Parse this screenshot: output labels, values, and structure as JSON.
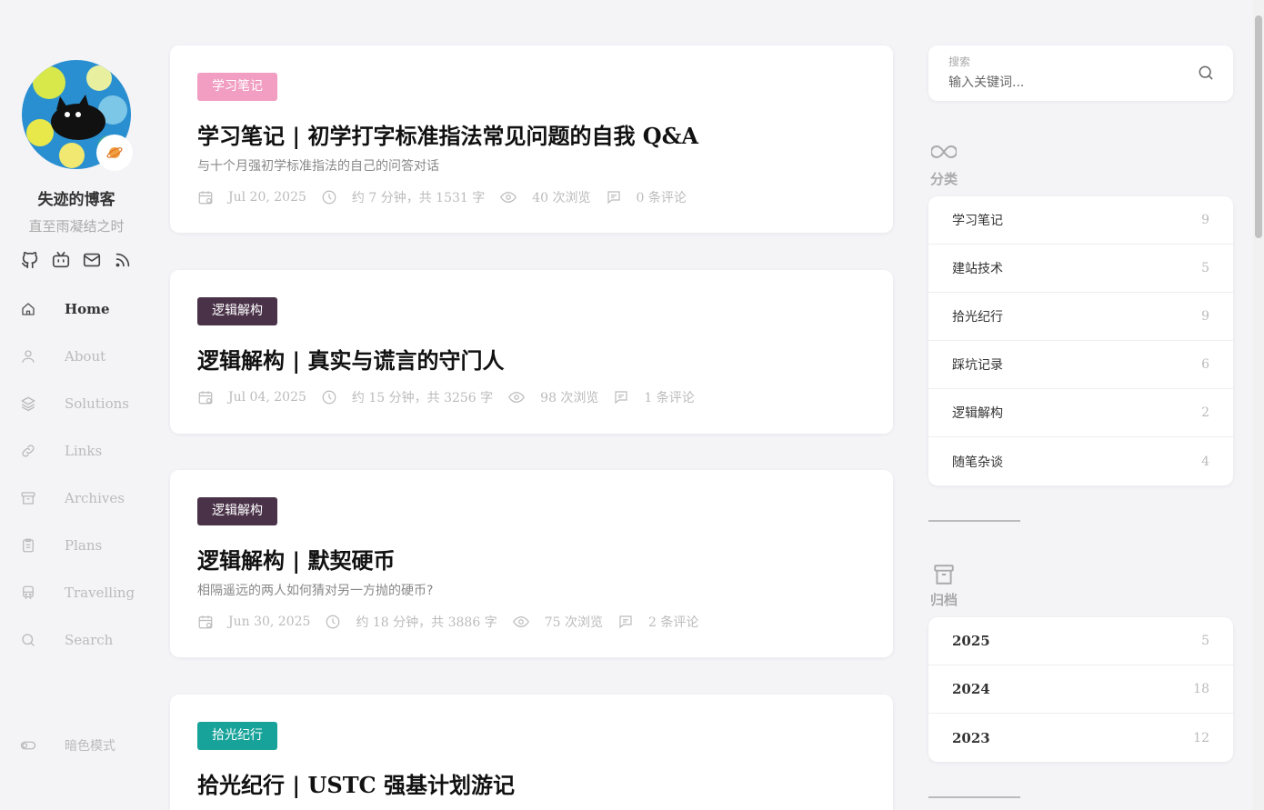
{
  "sidebar": {
    "blog_name": "失迹的博客",
    "motto": "直至雨凝结之时",
    "social": [
      "github-icon",
      "bilibili-icon",
      "mail-icon",
      "rss-icon"
    ],
    "nav": [
      {
        "label": "Home",
        "icon": "home-icon",
        "active": true
      },
      {
        "label": "About",
        "icon": "user-icon"
      },
      {
        "label": "Solutions",
        "icon": "layers-icon"
      },
      {
        "label": "Links",
        "icon": "link-icon"
      },
      {
        "label": "Archives",
        "icon": "archive-icon"
      },
      {
        "label": "Plans",
        "icon": "clipboard-icon"
      },
      {
        "label": "Travelling",
        "icon": "train-icon"
      },
      {
        "label": "Search",
        "icon": "search-icon"
      }
    ],
    "dark_mode_label": "暗色模式"
  },
  "posts": [
    {
      "tag": "学习笔记",
      "tag_color": "#f19ec2",
      "title": "学习笔记 | 初学打字标准指法常见问题的自我 Q&A",
      "subtitle": "与十个月强初学标准指法的自己的问答对话",
      "date": "Jul 20, 2025",
      "read": "约 7 分钟，共 1531 字",
      "views": "40 次浏览",
      "comments": "0 条评论"
    },
    {
      "tag": "逻辑解构",
      "tag_color": "#4a3349",
      "title": "逻辑解构 | 真实与谎言的守门人",
      "subtitle": "",
      "date": "Jul 04, 2025",
      "read": "约 15 分钟，共 3256 字",
      "views": "98 次浏览",
      "comments": "1 条评论"
    },
    {
      "tag": "逻辑解构",
      "tag_color": "#4a3349",
      "title": "逻辑解构 | 默契硬币",
      "subtitle": "相隔遥远的两人如何猜对另一方抛的硬币?",
      "date": "Jun 30, 2025",
      "read": "约 18 分钟，共 3886 字",
      "views": "75 次浏览",
      "comments": "2 条评论"
    },
    {
      "tag": "拾光纪行",
      "tag_color": "#17a39a",
      "title": "拾光纪行 | USTC 强基计划游记",
      "subtitle": "",
      "date": "",
      "read": "",
      "views": "",
      "comments": ""
    }
  ],
  "search": {
    "label": "搜索",
    "placeholder": "输入关键词..."
  },
  "categories": {
    "title": "分类",
    "items": [
      {
        "name": "学习笔记",
        "count": "9"
      },
      {
        "name": "建站技术",
        "count": "5"
      },
      {
        "name": "拾光纪行",
        "count": "9"
      },
      {
        "name": "踩坑记录",
        "count": "6"
      },
      {
        "name": "逻辑解构",
        "count": "2"
      },
      {
        "name": "随笔杂谈",
        "count": "4"
      }
    ]
  },
  "archives": {
    "title": "归档",
    "items": [
      {
        "name": "2025",
        "count": "5"
      },
      {
        "name": "2024",
        "count": "18"
      },
      {
        "name": "2023",
        "count": "12"
      }
    ]
  }
}
